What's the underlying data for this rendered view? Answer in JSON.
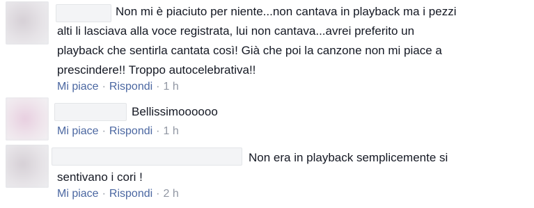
{
  "comments": [
    {
      "text_lines": [
        "Non mi è piaciuto per niente...non cantava in playback ma i pezzi",
        "alti li lasciava alla voce registrata, lui non cantava...avrei preferito un",
        "playback che sentirla cantata così! Già che poi la canzone non mi piace a",
        "prescindere!! Troppo autocelebrativa!!"
      ],
      "like_label": "Mi piace",
      "reply_label": "Rispondi",
      "separator": "·",
      "time": "1 h"
    },
    {
      "text_lines": [
        "Bellissimoooooo"
      ],
      "like_label": "Mi piace",
      "reply_label": "Rispondi",
      "separator": "·",
      "time": "1 h"
    },
    {
      "text_lines": [
        "Non era in playback semplicemente si",
        "sentivano i cori !"
      ],
      "like_label": "Mi piace",
      "reply_label": "Rispondi",
      "separator": "·",
      "time": "2 h"
    }
  ]
}
